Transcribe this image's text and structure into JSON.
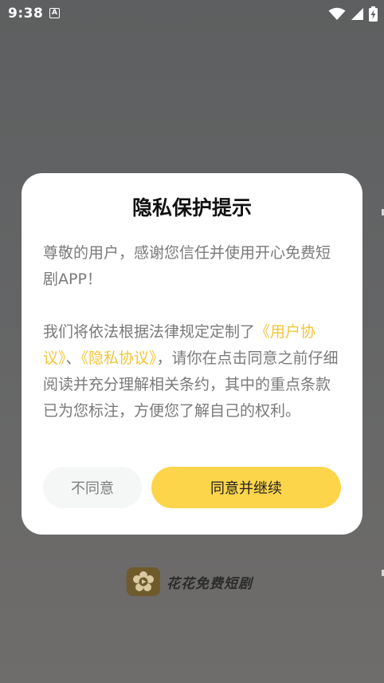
{
  "status_bar": {
    "time": "9:38",
    "notification_icon": "a-notification-icon",
    "icons": [
      "wifi-icon",
      "signal-icon",
      "battery-charging-icon"
    ]
  },
  "dialog": {
    "title": "隐私保护提示",
    "greeting": "尊敬的用户，感谢您信任并使用开心免费短剧APP！",
    "body_prefix": "我们将依法根据法律规定定制了",
    "user_agreement_link": "《用户协议》",
    "separator": "、",
    "privacy_policy_link": "《隐私协议》",
    "body_suffix": "，请你在点击同意之前仔细阅读并充分理解相关条约，其中的重点条款已为您标注，方便您了解自己的权利。",
    "disagree_label": "不同意",
    "agree_label": "同意并继续"
  },
  "brand": {
    "name": "花花免费短剧",
    "logo_icon": "flower-logo-icon"
  },
  "colors": {
    "accent": "#fdd54b",
    "link": "#f2c53a",
    "overlay": "#646566",
    "brand_logo": "#6f5a2c"
  }
}
